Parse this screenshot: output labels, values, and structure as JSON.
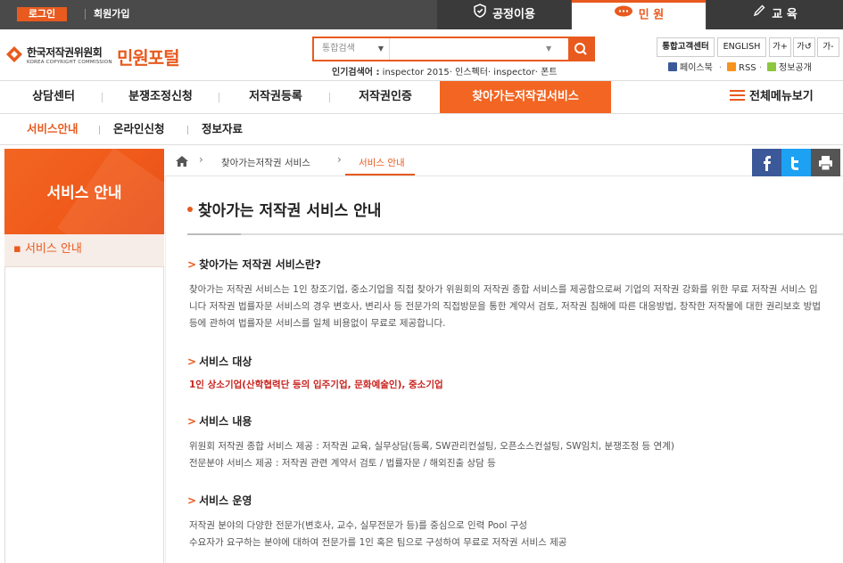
{
  "topbar": {
    "login": "로그인",
    "join": "회원가입",
    "tabs": [
      {
        "label": "공정이용",
        "icon": "shield-icon"
      },
      {
        "label": "민 원",
        "icon": "chat-icon"
      },
      {
        "label": "교 육",
        "icon": "pen-icon"
      }
    ]
  },
  "header": {
    "logo_ko": "한국저작권위원회",
    "logo_en": "KOREA COPYRIGHT COMMISSION",
    "portal_title": "민원포털",
    "search": {
      "select_value": "통합검색",
      "placeholder": ""
    },
    "popular_label": "인기검색어 :",
    "popular_terms": "inspector 2015· 인스펙터· inspector· 폰트",
    "util_buttons": [
      "통합고객센터",
      "ENGLISH",
      "가+",
      "가↺",
      "가-"
    ],
    "sns": [
      "페이스북",
      "RSS",
      "정보공개"
    ]
  },
  "mainnav": {
    "items": [
      "상담센터",
      "분쟁조정신청",
      "저작권등록",
      "저작권인증",
      "찾아가는저작권서비스"
    ],
    "all_menu": "전체메뉴보기"
  },
  "subnav": {
    "items": [
      "서비스안내",
      "온라인신청",
      "정보자료"
    ]
  },
  "sidebar": {
    "title": "서비스 안내",
    "menu_item": "▪ 서비스 안내"
  },
  "breadcrumb": {
    "items": [
      "찾아가는저작권 서비스",
      "서비스 안내"
    ]
  },
  "content": {
    "title": "찾아가는 저작권 서비스 안내",
    "sections": [
      {
        "heading": "찾아가는 저작권 서비스란?",
        "text": "찾아가는 저작권 서비스는 1인 창조기업, 중소기업을 직접 찾아가 위원회의 저작권 종합 서비스를 제공함으로써 기업의 저작권 강화를 위한 무료 저작권 서비스 입니다 저작권 법률자문 서비스의 경우 변호사, 변리사 등 전문가의 직접방문을 통한 계약서 검토, 저작권 침해에 따른 대응방법, 창작한 저작물에 대한 권리보호 방법 등에 관하여 법률자문 서비스를 일체 비용없이 무료로 제공합니다."
      },
      {
        "heading": "서비스 대상",
        "text": "1인 상소기업(산학협력단 등의 입주기업, 문화예술인), 중소기업"
      },
      {
        "heading": "서비스 내용",
        "lines": [
          "위원회 저작권 종합 서비스 제공 : 저작권 교육, 실무상담(등록, SW관리컨설팅, 오픈소스컨설팅, SW임치, 분쟁조정 등 연계)",
          "전문분야 서비스 제공 : 저작권 관련 계약서 검토 / 법률자문 / 해외진출 상담 등"
        ]
      },
      {
        "heading": "서비스 운영",
        "lines": [
          "저작권 분야의 다양한 전문가(변호사, 교수, 실무전문가 등)를 중심으로 인력 Pool 구성",
          "수요자가 요구하는 분야에 대하여 전문가를 1인 혹은 팀으로 구성하여 무료로 저작권 서비스 제공"
        ]
      }
    ]
  },
  "colors": {
    "accent": "#e85a1e",
    "topbar": "#4a4a4a",
    "facebook": "#3b5998",
    "twitter": "#1da1f2"
  }
}
